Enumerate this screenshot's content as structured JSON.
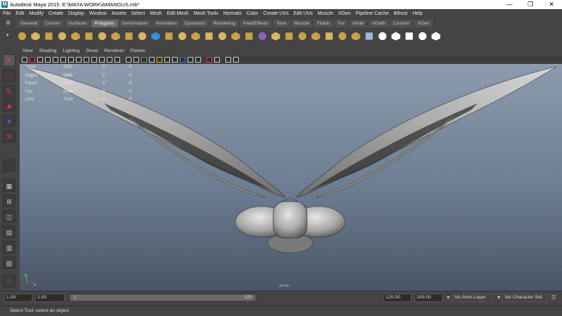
{
  "window": {
    "title": "Autodesk Maya 2015: E:\\MAYA WORK\\AMANGUS.mb*",
    "logo": "M",
    "minimize": "—",
    "maximize": "❐",
    "close": "✕"
  },
  "menubar": [
    "File",
    "Edit",
    "Modify",
    "Create",
    "Display",
    "Window",
    "Assets",
    "Select",
    "Mesh",
    "Edit Mesh",
    "Mesh Tools",
    "Normals",
    "Color",
    "Create UVs",
    "Edit UVs",
    "Muscle",
    "XGen",
    "Pipeline Cache",
    "Bifrost",
    "Help"
  ],
  "shelf": {
    "tabs": [
      "General",
      "Curves",
      "Surfaces",
      "Polygons",
      "Deformation",
      "Animation",
      "Dynamics",
      "Rendering",
      "PaintEffects",
      "Toon",
      "Muscle",
      "Fluids",
      "Fur",
      "nHair",
      "nCloth",
      "Custom",
      "XGen"
    ],
    "active_tab": "Polygons",
    "settings_icon": "⚙",
    "collapse_icon": "▾"
  },
  "panel": {
    "menus": [
      "View",
      "Shading",
      "Lighting",
      "Show",
      "Renderer",
      "Panels"
    ]
  },
  "hud": {
    "rows": [
      {
        "label": "Verts:",
        "v1": "2797",
        "v2": "0",
        "v3": "0"
      },
      {
        "label": "Edges:",
        "v1": "5668",
        "v2": "0",
        "v3": "0"
      },
      {
        "label": "Faces:",
        "v1": "2885",
        "v2": "0",
        "v3": "0"
      },
      {
        "label": "Tris:",
        "v1": "5446",
        "v2": "0",
        "v3": "0"
      },
      {
        "label": "UVs:",
        "v1": "7514",
        "v2": "0",
        "v3": "0"
      }
    ]
  },
  "viewport": {
    "camera": "persp",
    "axis_y": "y",
    "axis_x": "x"
  },
  "timeslider": {
    "start_field": "1.00",
    "current_field": "1.00",
    "range_start": "1",
    "range_end": "120",
    "end_field": "120.00",
    "max_field": "200.00",
    "anim_layer": "No Anim Layer",
    "character_set": "No Character Set"
  },
  "helpline": {
    "message": "Select Tool: select an object"
  },
  "colors": {
    "viewport_top": "#8c9cae",
    "viewport_bottom": "#4a5566",
    "ui_bg": "#444444",
    "maya_teal": "#1a7f8e"
  }
}
